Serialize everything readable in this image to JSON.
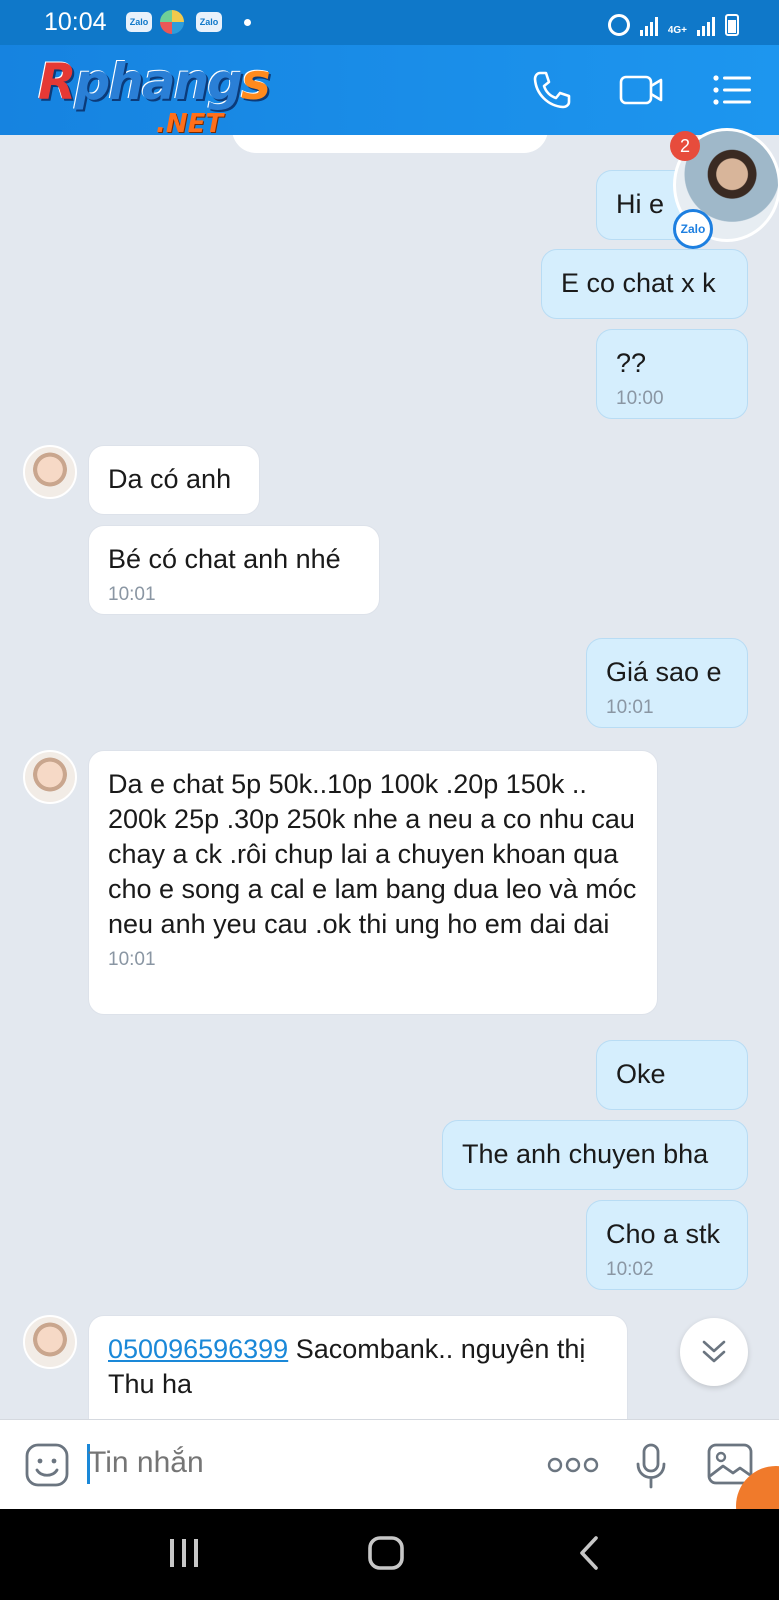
{
  "status_bar": {
    "time": "10:04",
    "apps": [
      "Zalo",
      "Zalo"
    ],
    "network": "4G+"
  },
  "header": {
    "logo_main_r": "R",
    "logo_main_rest": "phang",
    "logo_main_s": "s",
    "logo_net": ".NET",
    "icons": [
      "phone-icon",
      "video-call-icon",
      "menu-icon"
    ]
  },
  "chat_head": {
    "badge_count": "2",
    "app_label": "Zalo"
  },
  "messages": {
    "m1": {
      "text": "Hi e"
    },
    "m2": {
      "text": "E co chat x k"
    },
    "m3": {
      "text": "??",
      "time": "10:00"
    },
    "m4": {
      "text": "Da có anh"
    },
    "m5": {
      "text": "Bé có chat anh nhé",
      "time": "10:01"
    },
    "m6": {
      "text": "Giá sao e",
      "time": "10:01"
    },
    "m7": {
      "text": "Da e chat 5p 50k..10p 100k .20p 150k .. 200k 25p .30p 250k nhe a neu a co nhu cau chay a ck .rôi chup lai a chuyen khoan qua cho e song a cal e lam bang dua leo và móc neu anh yeu cau .ok thi ung ho  em dai dai",
      "time": "10:01"
    },
    "m8": {
      "text": "Oke"
    },
    "m9": {
      "text": "The anh chuyen bha"
    },
    "m10": {
      "text": "Cho a stk",
      "time": "10:02"
    },
    "m11": {
      "account": "050096596399",
      "text": " Sacombank.. nguyên thị Thu ha"
    }
  },
  "composer": {
    "placeholder": "Tin nhắn"
  },
  "colors": {
    "header": "#1683e0",
    "outgoing_bubble": "#d5eefd",
    "incoming_bubble": "#ffffff",
    "chat_background": "#e3e8ef",
    "link": "#1a88d8"
  }
}
